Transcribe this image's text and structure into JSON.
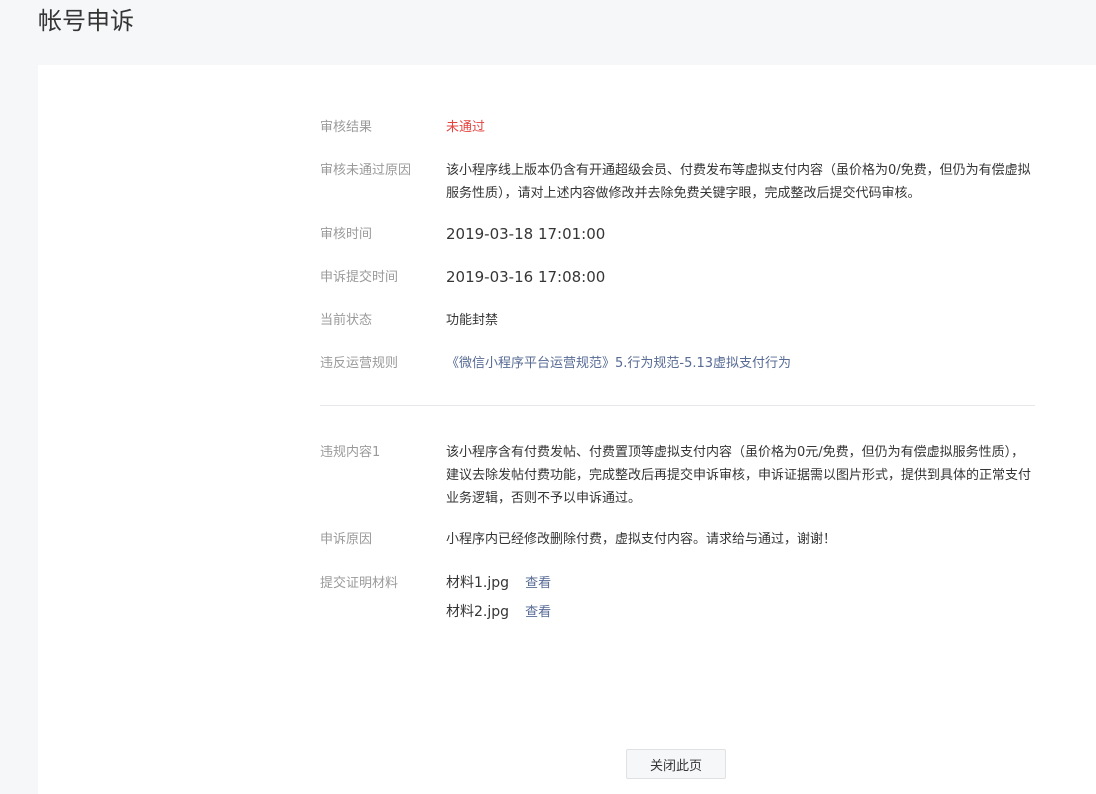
{
  "page": {
    "title": "帐号申诉"
  },
  "review": {
    "result_label": "审核结果",
    "result_value": "未通过",
    "reason_label": "审核未通过原因",
    "reason_value": "该小程序线上版本仍含有开通超级会员、付费发布等虚拟支付内容（虽价格为0/免费，但仍为有偿虚拟服务性质），请对上述内容做修改并去除免费关键字眼，完成整改后提交代码审核。",
    "time_label": "审核时间",
    "time_value": "2019-03-18 17:01:00",
    "submit_time_label": "申诉提交时间",
    "submit_time_value": "2019-03-16 17:08:00",
    "state_label": "当前状态",
    "state_value": "功能封禁",
    "rule_label": "违反运营规则",
    "rule_link": "《微信小程序平台运营规范》5.行为规范-5.13虚拟支付行为"
  },
  "violation": {
    "content_label": "违规内容1",
    "content_value": "该小程序含有付费发帖、付费置顶等虚拟支付内容（虽价格为0元/免费，但仍为有偿虚拟服务性质），建议去除发帖付费功能，完成整改后再提交申诉审核，申诉证据需以图片形式，提供到具体的正常支付业务逻辑，否则不予以申诉通过。",
    "appeal_reason_label": "申诉原因",
    "appeal_reason_value": "小程序内已经修改删除付费，虚拟支付内容。请求给与通过，谢谢！",
    "materials_label": "提交证明材料",
    "materials": [
      {
        "name": "材料1.jpg",
        "action": "查看"
      },
      {
        "name": "材料2.jpg",
        "action": "查看"
      }
    ]
  },
  "footer": {
    "close_label": "关闭此页"
  }
}
